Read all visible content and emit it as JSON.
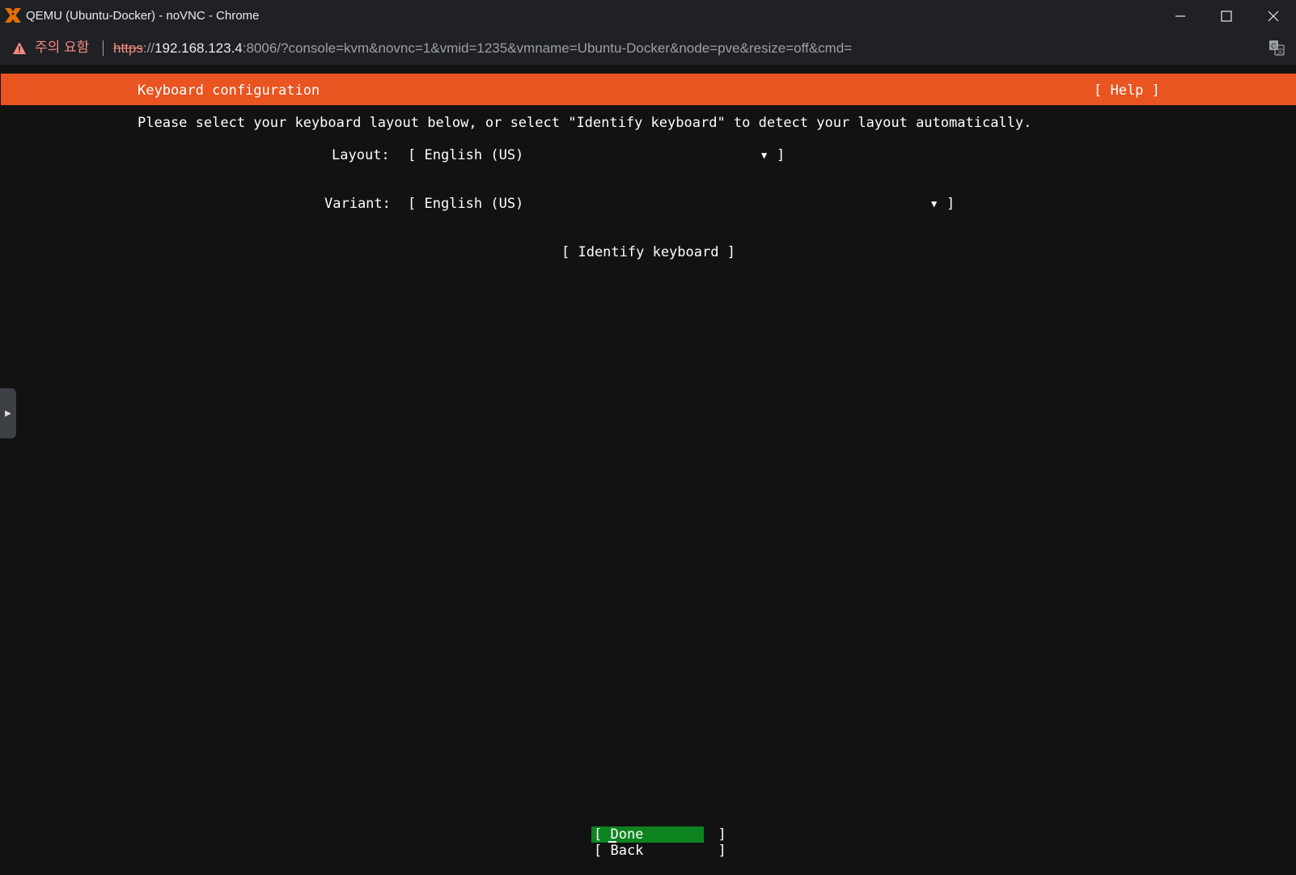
{
  "window": {
    "title": "QEMU (Ubuntu-Docker) - noVNC - Chrome",
    "controls": {
      "minimize_icon": "minimize-icon",
      "maximize_icon": "maximize-icon",
      "close_icon": "close-icon"
    },
    "logo_icon": "proxmox-logo-icon",
    "colors": {
      "logo_orange": "#e57000",
      "logo_black": "#000000"
    }
  },
  "addressbar": {
    "security_label": "주의 요함",
    "security_icon": "warning-triangle-icon",
    "url_scheme": "https",
    "url_separator": "://",
    "url_host": "192.168.123.4",
    "url_rest": ":8006/?console=kvm&novnc=1&vmid=1235&vmname=Ubuntu-Docker&node=pve&resize=off&cmd=",
    "translate_icon": "translate-icon"
  },
  "installer": {
    "header_title": "Keyboard configuration",
    "help_label": "[ Help ]",
    "instructions": "Please select your keyboard layout below, or select \"Identify keyboard\" to detect your layout automatically.",
    "layout": {
      "label": "Layout:",
      "value": "[ English (US)",
      "arrow": "▼",
      "close": "]"
    },
    "variant": {
      "label": "Variant:",
      "value": "[ English (US)",
      "arrow": "▼",
      "close": "]"
    },
    "identify_label": "[ Identify keyboard ]",
    "done_label": "[ Done         ]",
    "back_label": "[ Back         ]",
    "colors": {
      "header": "#e95420",
      "done_bg": "#0e8420",
      "background": "#121212"
    }
  },
  "novnc": {
    "sidebar_handle_icon": "expand-arrow-icon",
    "sidebar_handle_glyph": "▶"
  }
}
